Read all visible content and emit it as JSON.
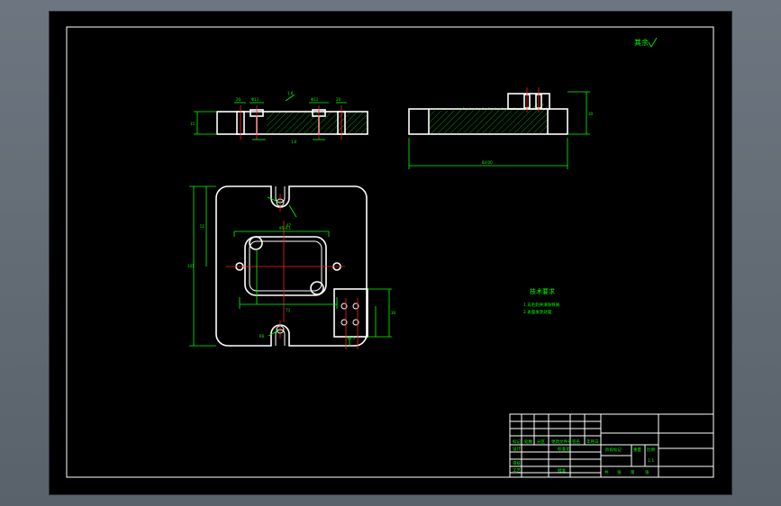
{
  "colors": {
    "background": "#000000",
    "geometry": "#ffffff",
    "dimension": "#00ff00",
    "centerline": "#ff2020"
  },
  "drawing": {
    "roughness_note": "其余",
    "technical_requirements": {
      "title": "技术要求",
      "items": [
        "1.去毛刺并清除铁屑.",
        "2.表面发黑处理."
      ]
    },
    "title_block": {
      "labels": [
        "标记",
        "处数",
        "分区",
        "更改文件号",
        "签名",
        "年月日",
        "设计",
        "标准化",
        "审核",
        "工艺",
        "批准",
        "阶段标记",
        "重量",
        "比例",
        "共",
        "张",
        "第",
        "张"
      ],
      "scale": "1:1"
    }
  }
}
